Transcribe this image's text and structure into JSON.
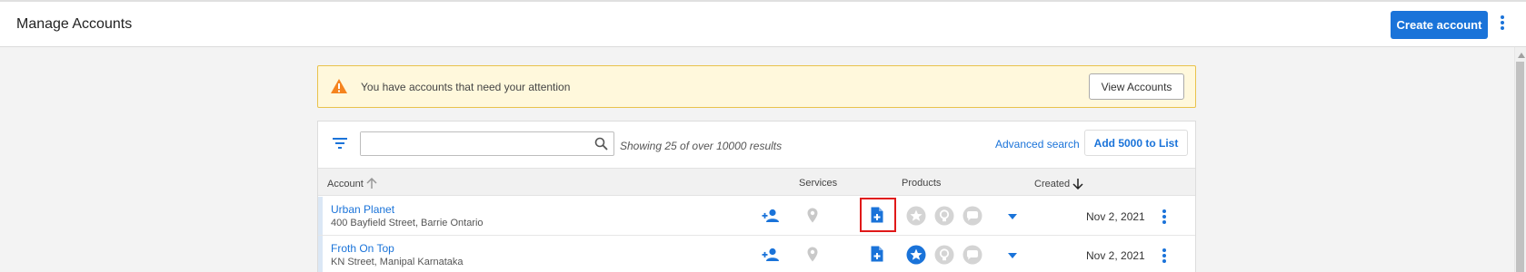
{
  "header": {
    "title": "Manage Accounts",
    "create_label": "Create account"
  },
  "alert": {
    "message": "You have accounts that need your attention",
    "button_label": "View Accounts"
  },
  "toolbar": {
    "search_value": "",
    "search_placeholder": "",
    "results_text": "Showing 25 of over 10000 results",
    "advanced_search": "Advanced search",
    "add_list_label": "Add 5000 to List"
  },
  "table": {
    "columns": {
      "account": "Account",
      "services": "Services",
      "products": "Products",
      "created": "Created"
    },
    "rows": [
      {
        "name": "Urban Planet",
        "address": "400 Bayfield Street, Barrie Ontario",
        "created": "Nov 2, 2021",
        "star_active": false
      },
      {
        "name": "Froth On Top",
        "address": "KN Street, Manipal Karnataka",
        "created": "Nov 2, 2021",
        "star_active": true
      }
    ]
  },
  "colors": {
    "accent": "#1a73d9",
    "alert_bg": "#fff8dc",
    "alert_border": "#e9c24c",
    "warning": "#f5841f",
    "highlight": "#e01919"
  },
  "icons": [
    "filter-icon",
    "search-icon",
    "warning-icon",
    "add-user-icon",
    "location-pin-icon",
    "document-plus-icon",
    "star-icon",
    "lightbulb-icon",
    "chat-icon",
    "chevron-down-icon",
    "more-vertical-icon",
    "sort-arrow-icon"
  ]
}
